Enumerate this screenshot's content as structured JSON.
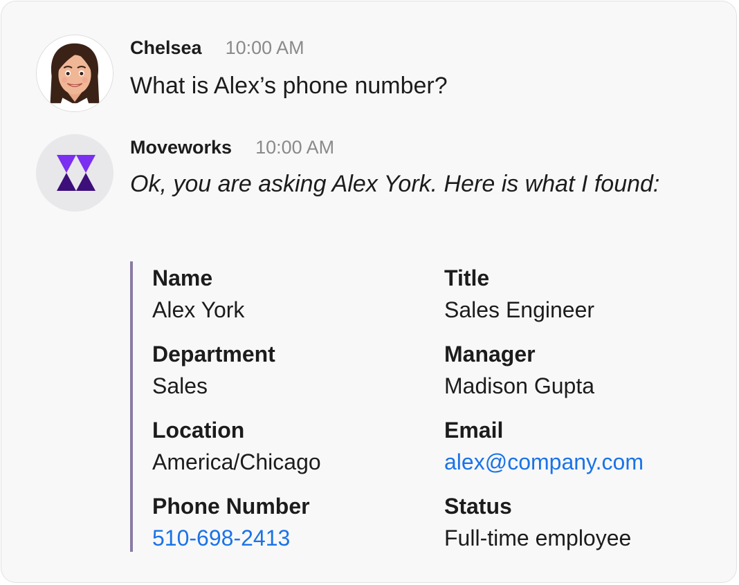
{
  "messages": {
    "user": {
      "sender": "Chelsea",
      "time": "10:00 AM",
      "text": "What is Alex’s phone number?"
    },
    "bot": {
      "sender": "Moveworks",
      "time": "10:00 AM",
      "text": "Ok, you are asking Alex York. Here is what I found:"
    }
  },
  "profile": {
    "name": {
      "label": "Name",
      "value": "Alex York"
    },
    "title": {
      "label": "Title",
      "value": "Sales Engineer"
    },
    "department": {
      "label": "Department",
      "value": "Sales"
    },
    "manager": {
      "label": "Manager",
      "value": "Madison Gupta"
    },
    "location": {
      "label": "Location",
      "value": "America/Chicago"
    },
    "email": {
      "label": "Email",
      "value": "alex@company.com"
    },
    "phone": {
      "label": "Phone Number",
      "value": "510-698-2413"
    },
    "status": {
      "label": "Status",
      "value": "Full-time employee"
    }
  },
  "colors": {
    "brand_purple": "#6a1fd0",
    "brand_purple_dark": "#3d0f7a",
    "link": "#1a73e8",
    "attachment_bar": "#8a7ba3"
  },
  "icons": {
    "user_avatar": "bitmoji-avatar",
    "bot_avatar": "moveworks-logo"
  }
}
